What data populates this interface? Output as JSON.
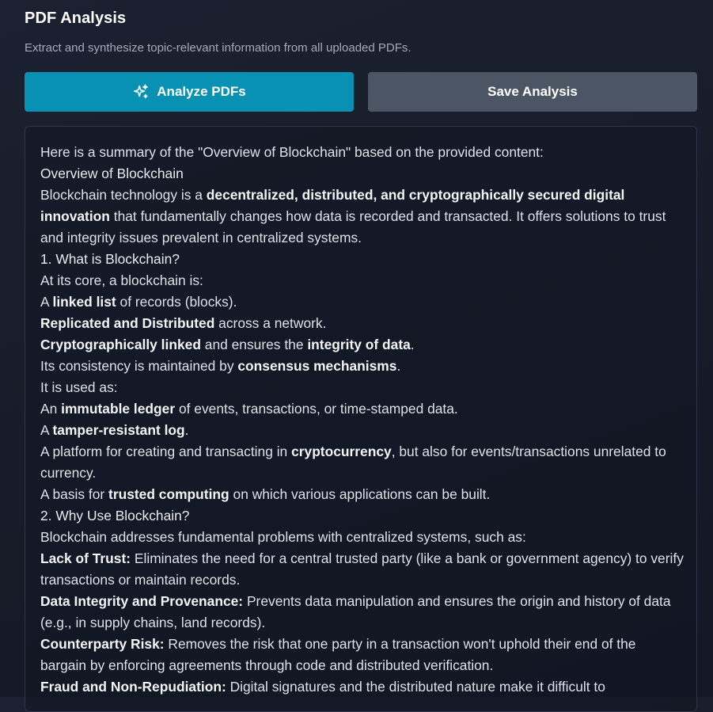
{
  "header": {
    "title": "PDF Analysis",
    "subtitle": "Extract and synthesize topic-relevant information from all uploaded PDFs."
  },
  "buttons": {
    "analyze": {
      "label": "Analyze PDFs",
      "icon": "sparkles-icon"
    },
    "save": {
      "label": "Save Analysis"
    }
  },
  "colors": {
    "analyze_button": "#0891b2",
    "save_button": "#4b5563",
    "background": "#171c29"
  },
  "analysis": {
    "intro": "Here is a summary of the \"Overview of Blockchain\" based on the provided content:",
    "heading": "Overview of Blockchain",
    "p1": {
      "a": "Blockchain technology is a ",
      "b": "decentralized, distributed, and cryptographically secured digital innovation",
      "c": " that fundamentally changes how data is recorded and transacted. It offers solutions to trust and integrity issues prevalent in centralized systems."
    },
    "s1_heading": "1. What is Blockchain?",
    "s1_intro": "At its core, a blockchain is:",
    "s1_items": [
      {
        "a": "A ",
        "b": "linked list",
        "c": " of records (blocks)."
      },
      {
        "a": "",
        "b": "Replicated and Distributed",
        "c": " across a network."
      },
      {
        "a": "",
        "b": "Cryptographically linked",
        "c": " and ensures the ",
        "d": "integrity of data",
        "e": "."
      },
      {
        "a": "Its consistency is maintained by ",
        "b": "consensus mechanisms",
        "c": "."
      }
    ],
    "s1_used": "It is used as:",
    "s1_uses": [
      {
        "a": "An ",
        "b": "immutable ledger",
        "c": " of events, transactions, or time-stamped data."
      },
      {
        "a": "A ",
        "b": "tamper-resistant log",
        "c": "."
      },
      {
        "a": "A platform for creating and transacting in ",
        "b": "cryptocurrency",
        "c": ", but also for events/transactions unrelated to currency."
      },
      {
        "a": "A basis for ",
        "b": "trusted computing",
        "c": " on which various applications can be built."
      }
    ],
    "s2_heading": "2. Why Use Blockchain?",
    "s2_intro": "Blockchain addresses fundamental problems with centralized systems, such as:",
    "s2_items": [
      {
        "b": "Lack of Trust:",
        "c": " Eliminates the need for a central trusted party (like a bank or government agency) to verify transactions or maintain records."
      },
      {
        "b": "Data Integrity and Provenance:",
        "c": " Prevents data manipulation and ensures the origin and history of data (e.g., in supply chains, land records)."
      },
      {
        "b": "Counterparty Risk:",
        "c": " Removes the risk that one party in a transaction won't uphold their end of the bargain by enforcing agreements through code and distributed verification."
      },
      {
        "b": "Fraud and Non-Repudiation:",
        "c": " Digital signatures and the distributed nature make it difficult to"
      }
    ]
  }
}
